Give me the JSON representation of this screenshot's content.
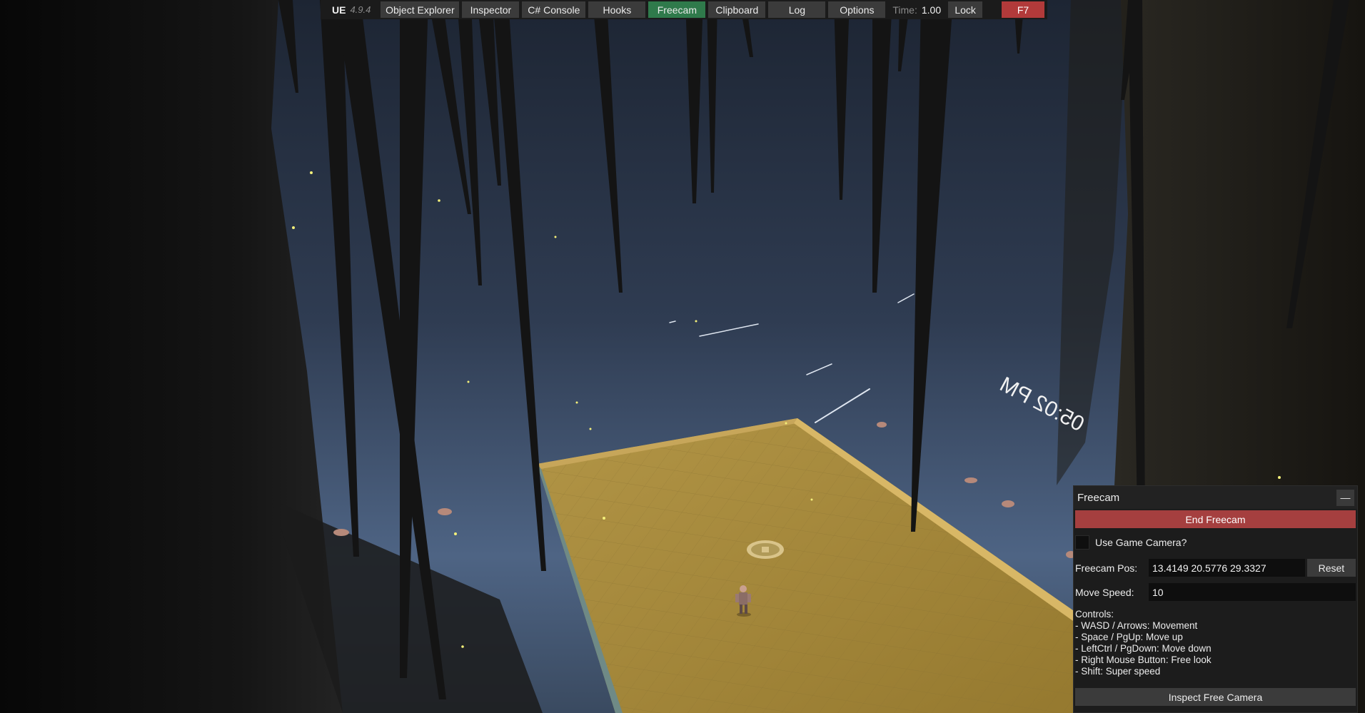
{
  "toolbar": {
    "brand_name": "UE",
    "brand_version": "4.9.4",
    "buttons": [
      {
        "label": "Object Explorer"
      },
      {
        "label": "Inspector"
      },
      {
        "label": "C# Console"
      },
      {
        "label": "Hooks"
      },
      {
        "label": "Freecam"
      },
      {
        "label": "Clipboard"
      },
      {
        "label": "Log"
      },
      {
        "label": "Options"
      }
    ],
    "time_label": "Time:",
    "time_value": "1.00",
    "lock_label": "Lock",
    "toggle_key_label": "F7",
    "active_tab": "Freecam"
  },
  "game_hud": {
    "clock_text": "05:02 PM"
  },
  "freecam_panel": {
    "title": "Freecam",
    "minimize_label": "—",
    "end_button_label": "End Freecam",
    "use_game_camera_label": "Use Game Camera?",
    "use_game_camera_checked": false,
    "position_label": "Freecam Pos:",
    "position_value": "13.4149 20.5776 29.3327",
    "reset_label": "Reset",
    "move_speed_label": "Move Speed:",
    "move_speed_value": "10",
    "controls_heading": "Controls:",
    "controls": [
      "- WASD / Arrows: Movement",
      "- Space / PgUp: Move up",
      "- LeftCtrl / PgDown: Move down",
      "- Right Mouse Button: Free look",
      "- Shift: Super speed"
    ],
    "inspect_button_label": "Inspect Free Camera"
  },
  "colors": {
    "toolbar_bg": "#1b1b1b",
    "button_bg": "#3b3b3b",
    "active_tab": "#2f7a4b",
    "danger": "#a53f3f",
    "f7_button": "#b23a3a",
    "sky_top": "#1d2533",
    "sky_horizon": "#4e6484",
    "floor": "#a68a3e"
  }
}
